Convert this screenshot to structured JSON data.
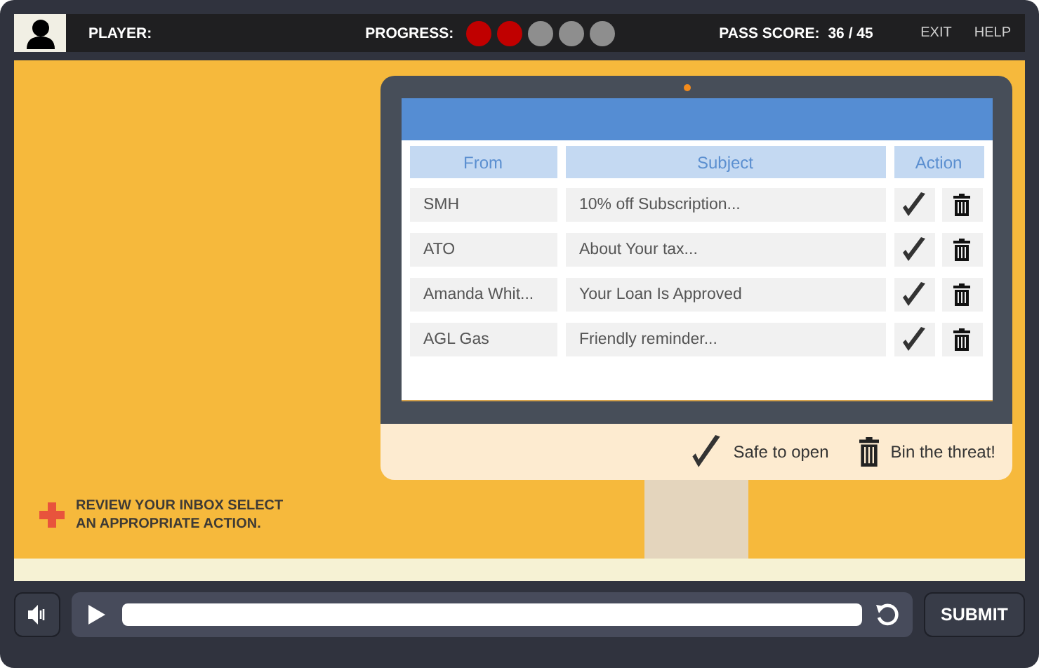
{
  "top_bar": {
    "player_label": "PLAYER:",
    "progress_label": "PROGRESS:",
    "progress": [
      {
        "done": true
      },
      {
        "done": true
      },
      {
        "done": false
      },
      {
        "done": false
      },
      {
        "done": false
      }
    ],
    "pass_score_label": "PASS SCORE:",
    "pass_score": "36 / 45",
    "links": [
      "EXIT",
      "HELP"
    ]
  },
  "inbox": {
    "columns": [
      "From",
      "Subject",
      "Action"
    ],
    "rows": [
      {
        "from": "SMH",
        "subject": "10% off Subscription..."
      },
      {
        "from": "ATO",
        "subject": "About Your tax..."
      },
      {
        "from": "Amanda Whit...",
        "subject": "Your Loan Is Approved"
      },
      {
        "from": "AGL Gas",
        "subject": "Friendly reminder..."
      }
    ]
  },
  "legend": {
    "safe": "Safe to open",
    "bin": "Bin the threat!"
  },
  "instruction": "REVIEW YOUR INBOX SELECT AN APPROPRIATE ACTION.",
  "controls": {
    "submit": "SUBMIT"
  }
}
